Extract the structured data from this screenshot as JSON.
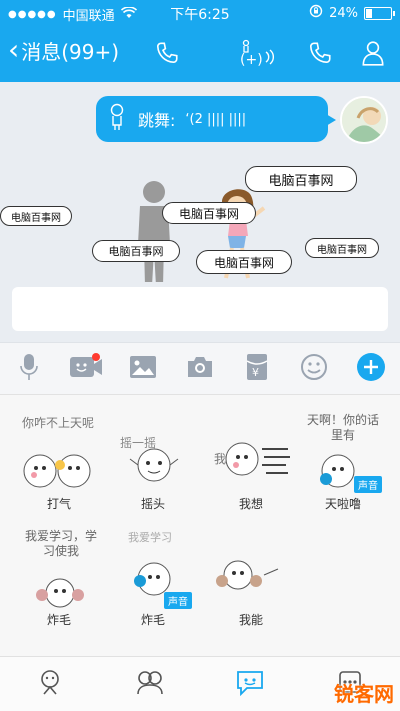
{
  "status": {
    "carrier": "中国联通",
    "time": "下午6:25",
    "battery_percent": "24%",
    "battery_level": 0.24
  },
  "header": {
    "back_label": "消息(99+)"
  },
  "message": {
    "label": "跳舞:",
    "waveform_text": "‘(2 |||| ||||"
  },
  "watermarks": [
    {
      "text": "电脑百事网"
    },
    {
      "text": "电脑百事网"
    },
    {
      "text": "电脑百事网"
    },
    {
      "text": "电脑百事网"
    },
    {
      "text": "电脑百事网"
    },
    {
      "text": "电脑百事网"
    }
  ],
  "stickers": [
    {
      "name": "打气",
      "caption": "你咋不上天呢"
    },
    {
      "name": "摇头",
      "caption": "摇一摇"
    },
    {
      "name": "我想",
      "caption": "我"
    },
    {
      "name": "天啦噜",
      "caption": "天啊！你的话里有",
      "voice_badge": "声音"
    },
    {
      "name": "炸毛",
      "caption": "我爱学习，学习使我"
    },
    {
      "name": "炸毛",
      "caption": "我爱学习",
      "voice_badge": "声音"
    },
    {
      "name": "我能",
      "caption": ""
    }
  ],
  "brand": "锐客网",
  "colors": {
    "accent": "#19a8ef",
    "badge_red": "#ff3b30",
    "brand_orange": "#ff6a00"
  },
  "icons": {
    "header": [
      "phone-icon",
      "voice-change-icon",
      "phone-icon",
      "profile-icon"
    ],
    "toolbar": [
      "microphone-icon",
      "video-call-icon",
      "image-icon",
      "camera-icon",
      "red-packet-icon",
      "emoji-icon",
      "plus-icon"
    ],
    "tabs": [
      "face-icon",
      "group-icon",
      "sticker-chat-icon",
      "more-icon"
    ]
  }
}
